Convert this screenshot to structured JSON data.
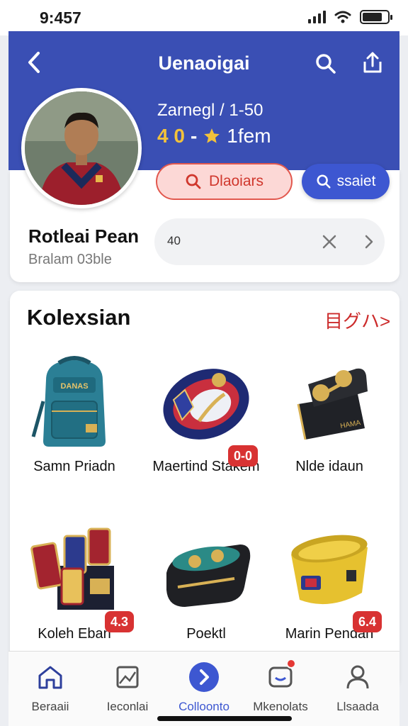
{
  "status_bar": {
    "time": "9:457"
  },
  "header": {
    "title": "Uenaoigai"
  },
  "profile": {
    "subtitle": "Zarnegl / 1-50",
    "stat_number": "4 0",
    "stat_separator": "-",
    "stat_label": "1fem",
    "primary_button_label": "Dlaoiars",
    "secondary_button_label": "ssaiet",
    "name": "Rotleai Pean",
    "handle": "Bralam 03ble",
    "search_value": "40"
  },
  "collection": {
    "title": "Kolexsian",
    "see_all": "目グハ>",
    "items": [
      {
        "name": "Samn Priadn",
        "badge": "",
        "icon": "backpack-icon"
      },
      {
        "name": "Maertind Stakem",
        "badge": "0-0",
        "icon": "wristband-icon"
      },
      {
        "name": "Nlde idaun",
        "badge": "",
        "icon": "wallet-icon"
      },
      {
        "name": "Koleh Eban",
        "badge": "4.3",
        "icon": "cup-set-icon"
      },
      {
        "name": "Poektl",
        "badge": "",
        "icon": "pouch-icon"
      },
      {
        "name": "Marin Pendan",
        "badge": "6.4",
        "icon": "bowl-icon"
      }
    ]
  },
  "bottom_nav": [
    {
      "label": "Beraaii",
      "icon": "home-icon",
      "active": false
    },
    {
      "label": "Ieconlai",
      "icon": "gallery-icon",
      "active": false
    },
    {
      "label": "Colloonto",
      "icon": "arrow-circle-icon",
      "active": true
    },
    {
      "label": "Mkenolats",
      "icon": "messages-icon",
      "active": false
    },
    {
      "label": "Llsaada",
      "icon": "profile-icon",
      "active": false
    }
  ],
  "colors": {
    "header": "#3a4fb4",
    "accent_blue": "#3d57d1",
    "accent_red": "#d83232",
    "star": "#f2c23b"
  }
}
